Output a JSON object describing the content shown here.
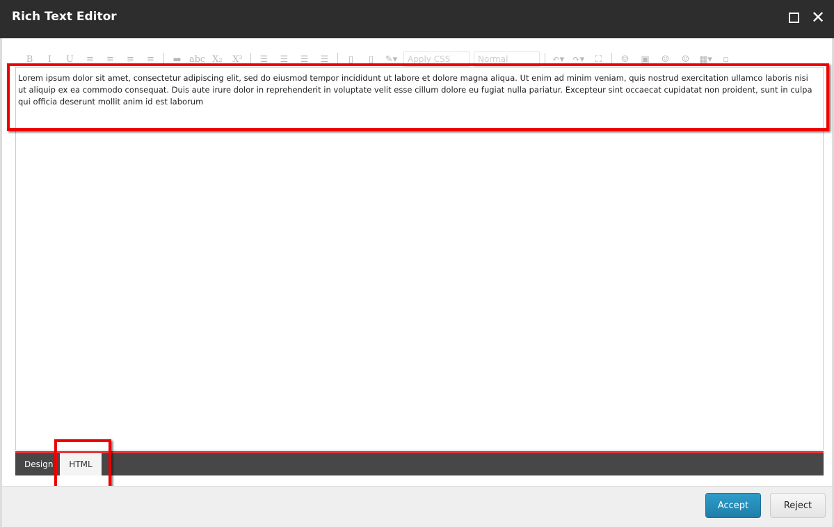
{
  "window": {
    "title": "Rich Text Editor"
  },
  "toolbar": {
    "group1": [
      "B",
      "I",
      "U",
      "≡",
      "≡",
      "≡",
      "≡"
    ],
    "group2": [
      "▬",
      "abc",
      "X₂",
      "X²"
    ],
    "group3": [
      "☰",
      "☰",
      "☰",
      "☰"
    ],
    "group4": [
      "▯",
      "▯",
      "✎▾"
    ],
    "css_class_placeholder": "Apply CSS Cl...",
    "format_value": "Normal",
    "group5": [
      "↶▾",
      "↷▾",
      "⛶"
    ],
    "group6": [
      "☺",
      "▣",
      "☺",
      "☺",
      "▦▾",
      "▫"
    ]
  },
  "editor": {
    "content": "Lorem ipsum dolor sit amet, consectetur adipiscing elit, sed do eiusmod tempor incididunt ut labore et dolore magna aliqua. Ut enim ad minim veniam, quis nostrud exercitation ullamco laboris nisi ut aliquip ex ea commodo consequat. Duis aute irure dolor in reprehenderit in voluptate velit esse cillum dolore eu fugiat nulla pariatur. Excepteur sint occaecat cupidatat non proident, sunt in culpa qui officia deserunt mollit anim id est laborum"
  },
  "tabs": [
    {
      "label": "Design"
    },
    {
      "label": "HTML",
      "active": true
    }
  ],
  "buttons": {
    "accept": "Accept",
    "reject": "Reject"
  },
  "colors": {
    "accent": "#2389b8",
    "highlight": "#e00000",
    "titlebar": "#2d2d2d"
  }
}
